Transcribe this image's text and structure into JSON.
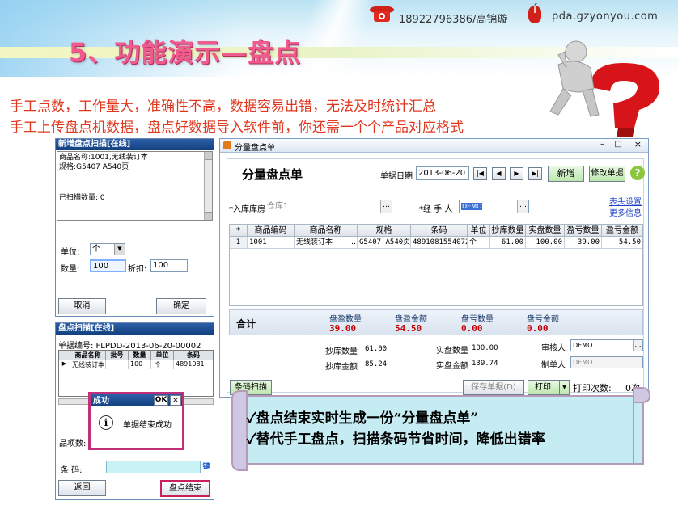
{
  "header": {
    "phone": "18922796386/高锦璇",
    "website": "pda.gzyonyou.com",
    "title": "5、功能演示—盘点"
  },
  "subtitles": [
    "手工点数，工作量大，准确性不高，数据容易出错，无法及时统计汇总",
    "手工上传盘点机数据，盘点好数据导入软件前，你还需一个个产品对应格式"
  ],
  "pda1": {
    "title": "新增盘点扫描[在线]",
    "product_line": "商品名称:1001,无线装订本",
    "spec_line": "规格:G5407 A540页",
    "scanned_line": "已扫描数量: 0",
    "unit_label": "单位:",
    "unit_value": "个",
    "qty_label": "数量:",
    "qty_value": "100",
    "discount_label": "折扣:",
    "discount_value": "100",
    "cancel": "取消",
    "ok": "确定"
  },
  "pda2": {
    "title": "盘点扫描[在线]",
    "doc_no": "单据编号:  FLPDD-2013-06-20-00002",
    "columns": [
      "商品名称",
      "批号",
      "数量",
      "单位",
      "条码"
    ],
    "row": [
      "无线装订本",
      "",
      "100",
      "个",
      "4891081"
    ],
    "items_label": "品项数:",
    "barcode_label": "条  码:",
    "kbd": "键",
    "back": "返回",
    "finish": "盘点结束"
  },
  "dialog": {
    "title": "成功",
    "ok": "OK",
    "close": "×",
    "message": "单据结束成功"
  },
  "app": {
    "window_title": "分量盘点单",
    "form_title": "分量盘点单",
    "date_label": "单据日期",
    "date_value": "2013-06-20",
    "btn_new": "新增",
    "btn_edit": "修改单据",
    "help": "?",
    "warehouse_label": "*入库库房",
    "warehouse_value": "仓库1",
    "handler_label": "*经 手 人",
    "handler_value": "DEMO",
    "link_header": "表头设置",
    "link_more": "更多信息",
    "ellipsis": "…",
    "columns": [
      "*",
      "商品编码",
      "商品名称",
      "规格",
      "条码",
      "单位",
      "抄库数量",
      "实盘数量",
      "盈亏数量",
      "盈亏金额"
    ],
    "rows": [
      [
        "1",
        "1001",
        "无线装订本",
        "G5407 A540页",
        "4891081554072",
        "个",
        "61.00",
        "100.00",
        "39.00",
        "54.50"
      ]
    ],
    "total_label": "合计",
    "summary": [
      {
        "label": "盘盈数量",
        "value": "39.00"
      },
      {
        "label": "盘盈金额",
        "value": "54.50"
      },
      {
        "label": "盘亏数量",
        "value": "0.00"
      },
      {
        "label": "盘亏金额",
        "value": "0.00"
      }
    ],
    "book_qty_label": "抄库数量",
    "book_qty": "61.00",
    "book_amt_label": "抄库金额",
    "book_amt": "85.24",
    "real_qty_label": "实盘数量",
    "real_qty": "100.00",
    "real_amt_label": "实盘金额",
    "real_amt": "139.74",
    "auditor_label": "审核人",
    "auditor": "DEMO",
    "maker_label": "制单人",
    "maker": "DEMO",
    "btn_scan": "条码扫描",
    "btn_save": "保存单据(D)",
    "btn_print": "打印",
    "print_count_label": "打印次数:",
    "print_count": "0次"
  },
  "scroll": {
    "line1": "✓盘点结束实时生成一份“分量盘点单”",
    "line2": "✓替代手工盘点，扫描条码节省时间，降低出错率"
  },
  "colors": {
    "accent": "#f05a8c",
    "subtitle": "#e0381f",
    "titlebar": "#1e4f96",
    "value_red": "#c00000"
  }
}
